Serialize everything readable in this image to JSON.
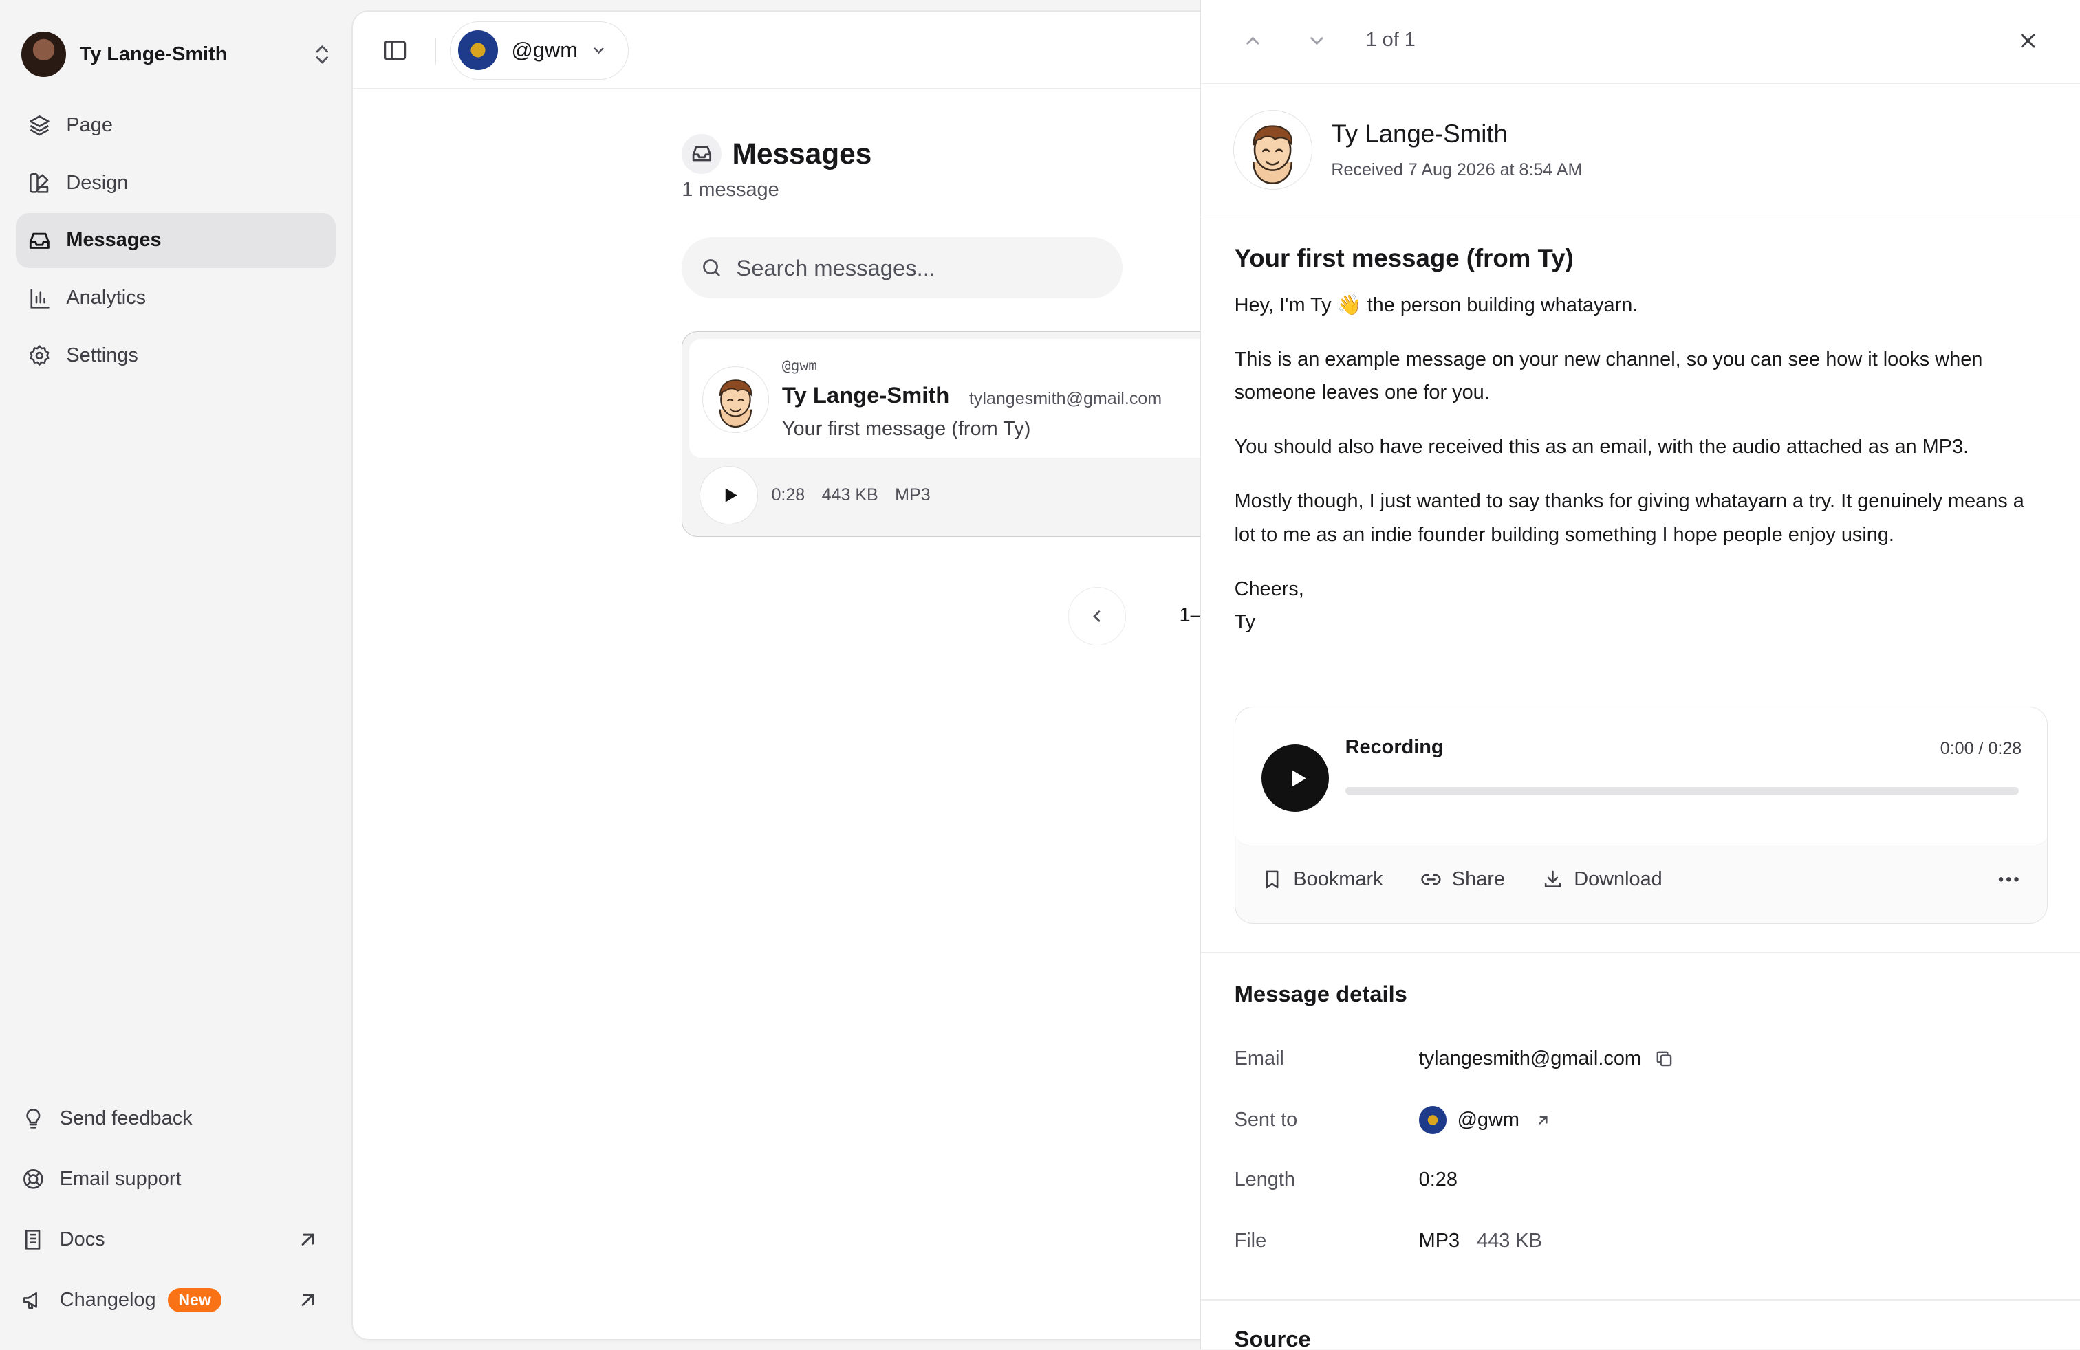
{
  "sidebar": {
    "user_name": "Ty Lange-Smith",
    "nav": [
      {
        "label": "Page",
        "icon": "layers-icon"
      },
      {
        "label": "Design",
        "icon": "palette-icon"
      },
      {
        "label": "Messages",
        "icon": "inbox-icon",
        "active": true
      },
      {
        "label": "Analytics",
        "icon": "bar-chart-icon"
      },
      {
        "label": "Settings",
        "icon": "gear-icon"
      }
    ],
    "bottom": [
      {
        "label": "Send feedback",
        "icon": "lightbulb-icon"
      },
      {
        "label": "Email support",
        "icon": "lifebuoy-icon"
      },
      {
        "label": "Docs",
        "icon": "book-icon"
      },
      {
        "label": "Changelog",
        "icon": "megaphone-icon",
        "badge": "New"
      }
    ]
  },
  "topbar": {
    "channel_handle": "@gwm"
  },
  "messages": {
    "title": "Messages",
    "count_label": "1 message",
    "search_placeholder": "Search messages...",
    "items": [
      {
        "handle": "@gwm",
        "name": "Ty Lange-Smith",
        "email": "tylangesmith@gmail.com",
        "subject": "Your first message (from Ty)",
        "duration": "0:28",
        "size": "443 KB",
        "format": "MP3"
      }
    ],
    "pager_label": "1–"
  },
  "panel": {
    "position_label": "1 of 1",
    "sender_name": "Ty Lange-Smith",
    "received": "Received 7 Aug 2026 at 8:54 AM",
    "subject": "Your first message (from Ty)",
    "paragraphs": [
      "Hey, I'm Ty 👋 the person building whatayarn.",
      "This is an example message on your new channel, so you can see how it looks when someone leaves one for you.",
      "You should also have received this as an email, with the audio attached as an MP3.",
      "Mostly though, I just wanted to say thanks for giving whatayarn a try. It genuinely means a lot to me as an indie founder building something I hope people enjoy using."
    ],
    "signoff_1": "Cheers,",
    "signoff_2": "Ty",
    "player": {
      "title": "Recording",
      "current": "0:00",
      "total": "0:28",
      "progress": 0,
      "bookmark_label": "Bookmark",
      "share_label": "Share",
      "download_label": "Download"
    },
    "details": {
      "title": "Message details",
      "email_key": "Email",
      "email_val": "tylangesmith@gmail.com",
      "sent_to_key": "Sent to",
      "sent_to_val": "@gwm",
      "length_key": "Length",
      "length_val": "0:28",
      "file_key": "File",
      "file_format": "MP3",
      "file_size": "443 KB"
    },
    "source_title": "Source"
  },
  "colors": {
    "accent_badge": "#f97316",
    "active_nav_bg": "#e4e4e7",
    "channel_avatar": "#1e3a8a"
  }
}
